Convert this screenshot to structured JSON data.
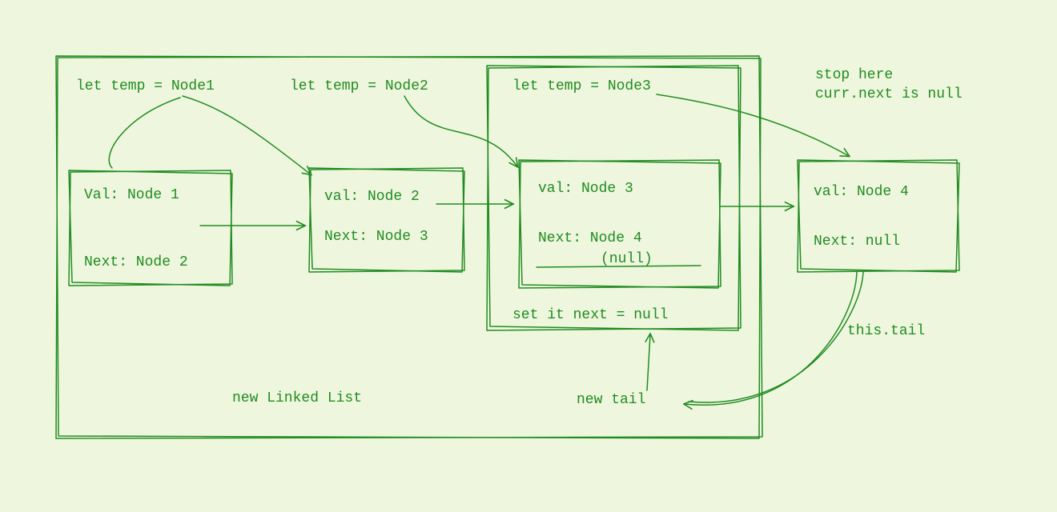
{
  "diagram": {
    "title": "new Linked List",
    "temp_labels": {
      "temp1": "let temp = Node1",
      "temp2": "let temp = Node2",
      "temp3": "let temp = Node3"
    },
    "nodes": {
      "n1": {
        "val_label": "Val: Node 1",
        "next_label": "Next: Node 2"
      },
      "n2": {
        "val_label": "val: Node 2",
        "next_label": "Next: Node 3"
      },
      "n3": {
        "val_label": "val: Node 3",
        "next_label": "Next: Node 4",
        "next_extra": "(null)"
      },
      "n4": {
        "val_label": "val: Node 4",
        "next_label": "Next: null"
      }
    },
    "annotations": {
      "stop1": "stop here",
      "stop2": "curr.next is null",
      "set_next_null": "set it next = null",
      "new_tail": "new tail",
      "this_tail": "this.tail"
    }
  }
}
